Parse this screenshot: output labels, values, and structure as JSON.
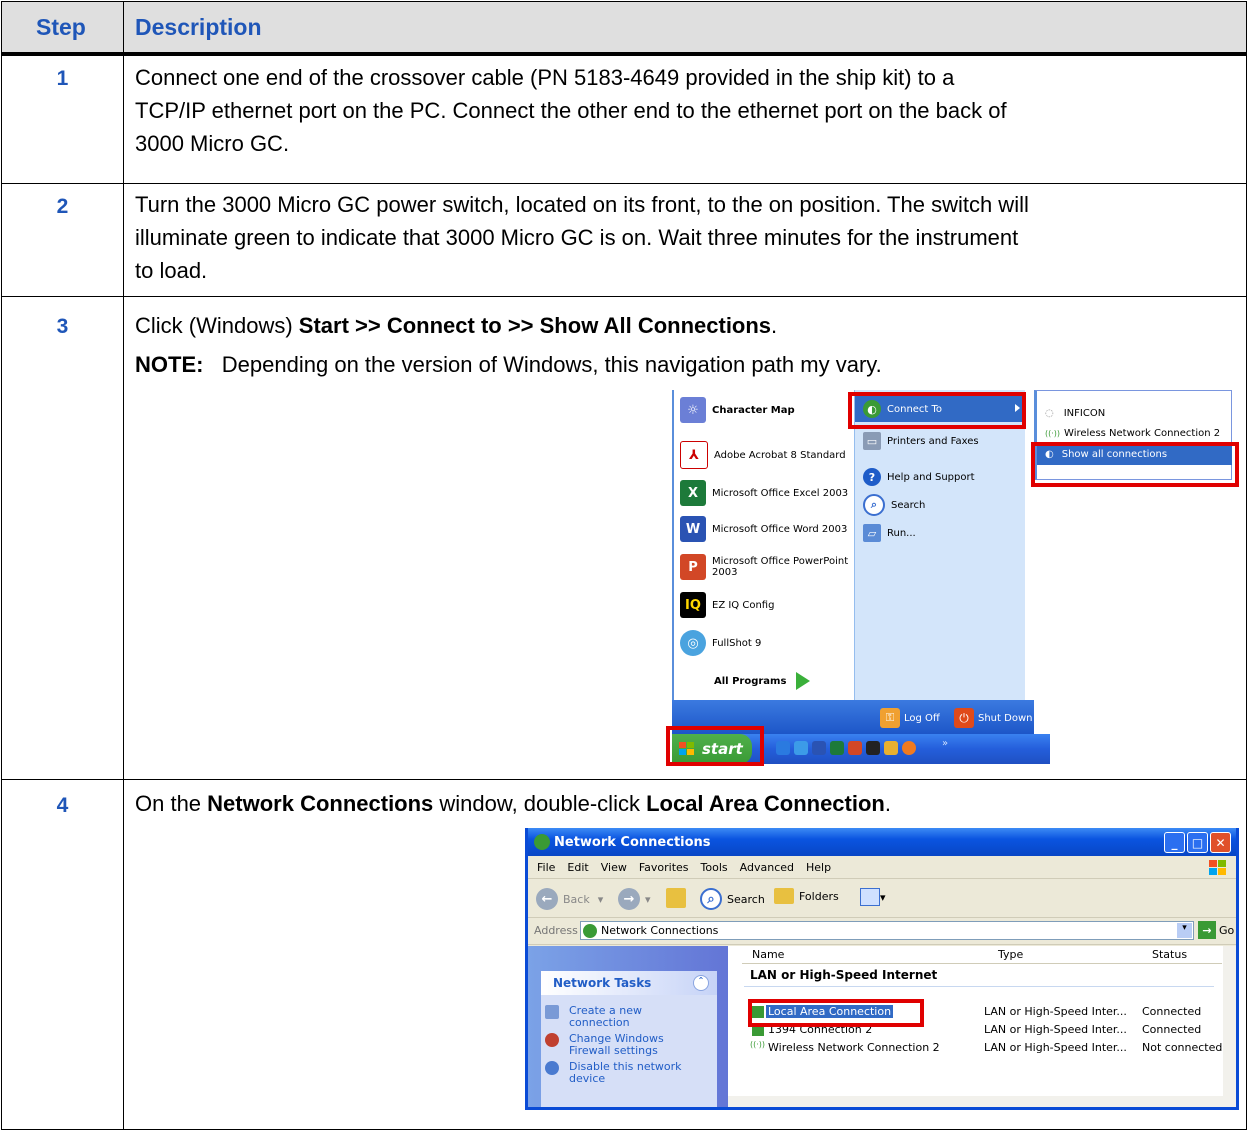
{
  "table": {
    "header": {
      "step": "Step",
      "description": "Description"
    },
    "rows": [
      {
        "step": "1",
        "lines": [
          "Connect one end of the crossover cable (PN 5183-4649 provided in the ship kit) to a",
          "TCP/IP ethernet port on the PC. Connect the other end to the ethernet port on the back of",
          "3000 Micro GC."
        ]
      },
      {
        "step": "2",
        "lines": [
          "Turn the 3000 Micro GC power switch, located on its front, to the on position. The switch will",
          "illuminate green to indicate that 3000 Micro GC is on. Wait three minutes for the instrument",
          "to load."
        ]
      },
      {
        "step": "3",
        "pre": "Click (Windows) ",
        "bold": "Start >> Connect to >> Show All Connections",
        "post": ".",
        "note_label": "NOTE:",
        "note_text": "Depending on the version of Windows, this navigation path my vary."
      },
      {
        "step": "4",
        "pre": "On the ",
        "bold1": "Network Connections",
        "mid": " window, double-click ",
        "bold2": "Local Area Connection",
        "post": "."
      }
    ]
  },
  "start_menu": {
    "left_items": [
      "Character Map",
      "Adobe Acrobat 8 Standard",
      "Microsoft Office Excel 2003",
      "Microsoft Office Word 2003",
      "Microsoft Office PowerPoint",
      "2003",
      "EZ IQ Config",
      "FullShot 9"
    ],
    "all_programs": "All Programs",
    "right_items": [
      "Connect To",
      "Printers and Faxes",
      "Help and Support",
      "Search",
      "Run..."
    ],
    "submenu": [
      "INFICON",
      "Wireless Network Connection 2",
      "Show all connections"
    ],
    "log_off": "Log Off",
    "shut_down": "Shut Down",
    "start": "start",
    "taskbar_more": "»"
  },
  "network_window": {
    "title": "Network Connections",
    "menu": [
      "File",
      "Edit",
      "View",
      "Favorites",
      "Tools",
      "Advanced",
      "Help"
    ],
    "toolbar": {
      "back": "Back",
      "search": "Search",
      "folders": "Folders"
    },
    "address_label": "Address",
    "address_value": "Network Connections",
    "go": "Go",
    "tasks_title": "Network Tasks",
    "tasks": [
      [
        "Create a new",
        "connection"
      ],
      [
        "Change Windows",
        "Firewall settings"
      ],
      [
        "Disable this network",
        "device"
      ]
    ],
    "columns": {
      "name": "Name",
      "type": "Type",
      "status": "Status"
    },
    "group": "LAN or High-Speed Internet",
    "rows": [
      {
        "name": "Local Area Connection",
        "type": "LAN or High-Speed Inter...",
        "status": "Connected"
      },
      {
        "name": "1394 Connection 2",
        "type": "LAN or High-Speed Inter...",
        "status": "Connected"
      },
      {
        "name": "Wireless Network Connection 2",
        "type": "LAN or High-Speed Inter...",
        "status": "Not connected"
      }
    ]
  },
  "colors": {
    "step_blue": "#1f56b8",
    "highlight_red": "#e00000",
    "xp_blue": "#0a54e0",
    "xp_green": "#3a9a35"
  }
}
